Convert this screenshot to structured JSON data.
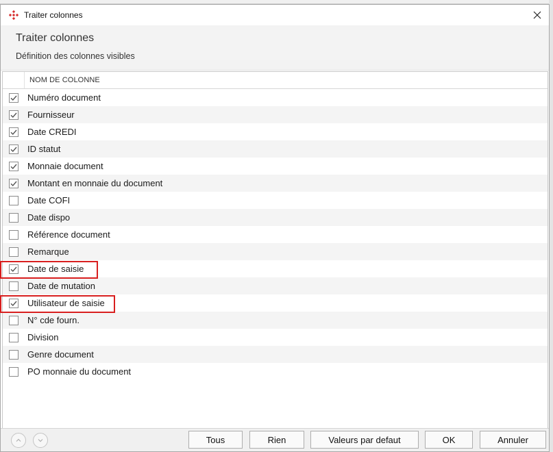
{
  "window": {
    "title": "Traiter colonnes",
    "close_icon": "close-icon",
    "app_icon": "app-logo-icon"
  },
  "header": {
    "title": "Traiter colonnes",
    "subtitle": "Définition des colonnes visibles"
  },
  "grid": {
    "column_header": "NOM DE COLONNE",
    "rows": [
      {
        "label": "Numéro document",
        "checked": true
      },
      {
        "label": "Fournisseur",
        "checked": true
      },
      {
        "label": "Date CREDI",
        "checked": true
      },
      {
        "label": "ID statut",
        "checked": true
      },
      {
        "label": "Monnaie document",
        "checked": true
      },
      {
        "label": "Montant en monnaie du document",
        "checked": true
      },
      {
        "label": "Date COFI",
        "checked": false
      },
      {
        "label": "Date dispo",
        "checked": false
      },
      {
        "label": "Référence document",
        "checked": false
      },
      {
        "label": "Remarque",
        "checked": false
      },
      {
        "label": "Date de saisie",
        "checked": true
      },
      {
        "label": "Date de mutation",
        "checked": false
      },
      {
        "label": "Utilisateur de saisie",
        "checked": true
      },
      {
        "label": "N° cde fourn.",
        "checked": false
      },
      {
        "label": "Division",
        "checked": false
      },
      {
        "label": "Genre document",
        "checked": false
      },
      {
        "label": "PO monnaie du document",
        "checked": false
      }
    ]
  },
  "footer": {
    "move_up_icon": "chevron-up-icon",
    "move_down_icon": "chevron-down-icon",
    "buttons": {
      "all": "Tous",
      "none": "Rien",
      "defaults": "Valeurs par defaut",
      "ok": "OK",
      "cancel": "Annuler"
    }
  },
  "colors": {
    "highlight": "#d81e1e",
    "app_icon": "#d62c2c",
    "check": "#555555"
  }
}
